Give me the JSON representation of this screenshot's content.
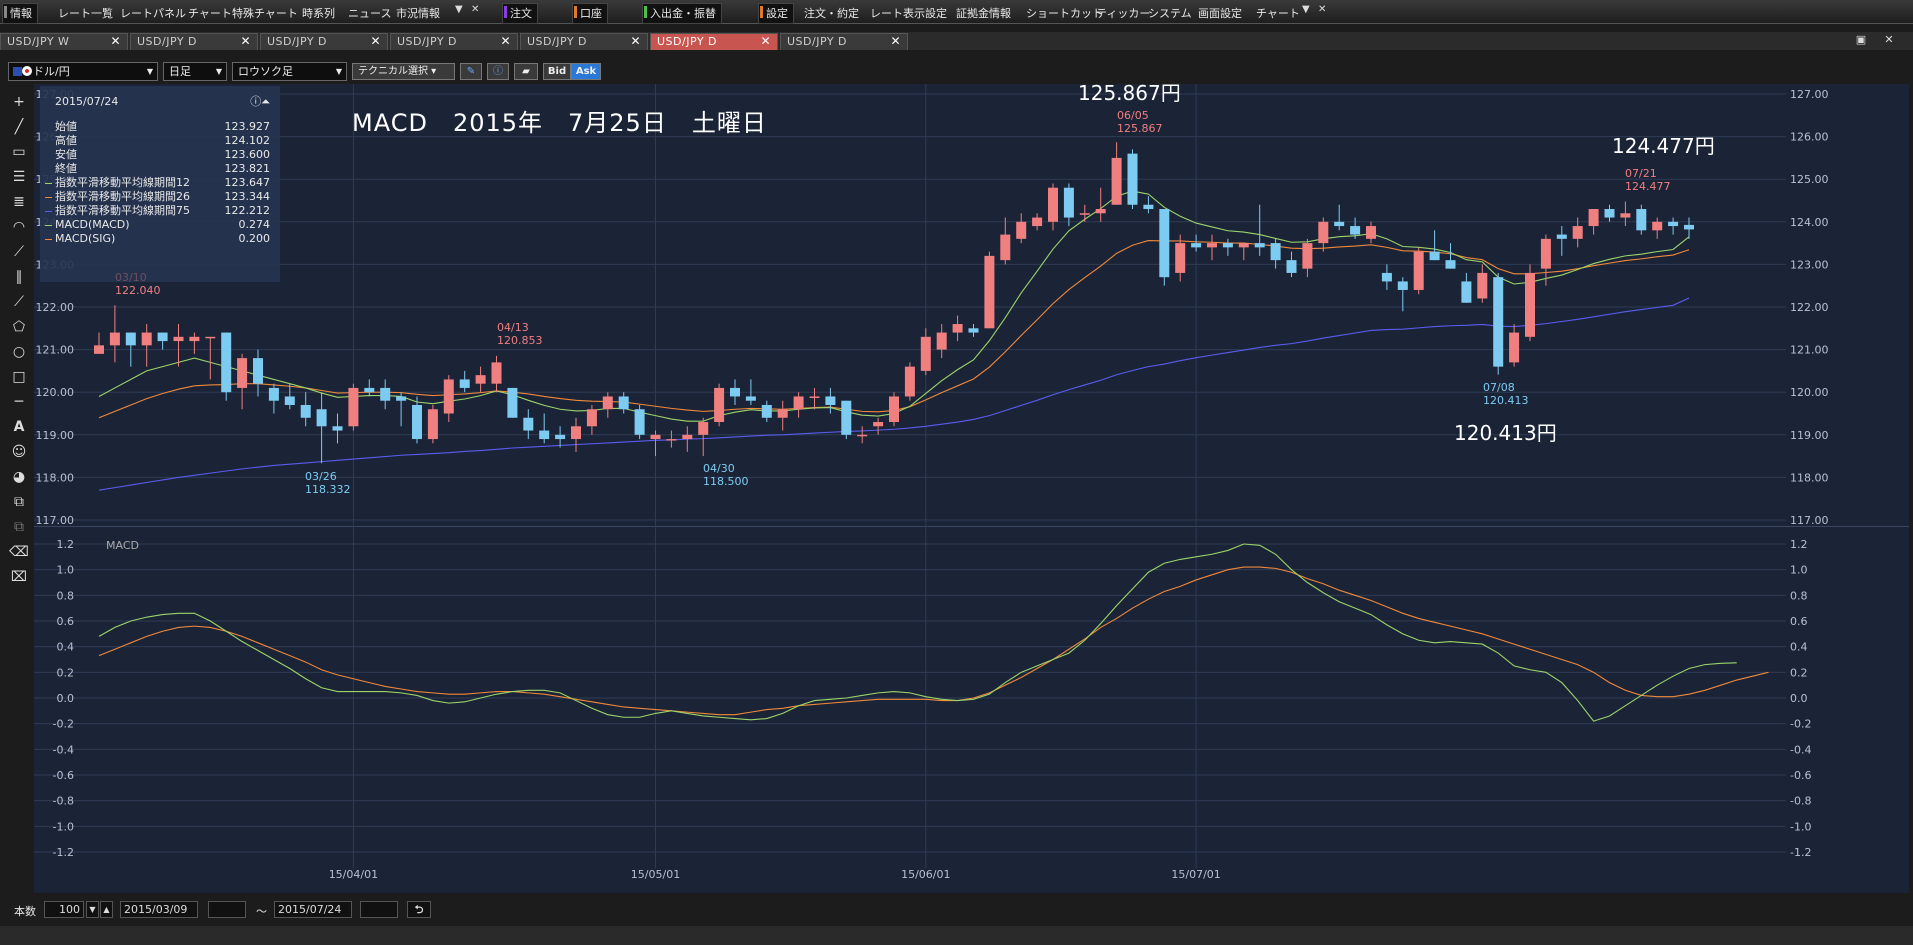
{
  "menu": {
    "items": [
      "情報",
      "レート一覧",
      "レートパネル",
      "チャート",
      "特殊チャート",
      "時系列",
      "ニュース",
      "市況情報",
      "注文",
      "口座",
      "入出金・振替",
      "設定",
      "注文・約定",
      "レート表示設定",
      "証拠金情報",
      "ショートカット",
      "ティッカー",
      "システム",
      "画面設定",
      "チャート"
    ]
  },
  "tabs": [
    {
      "label": "USD/JPY W"
    },
    {
      "label": "USD/JPY D"
    },
    {
      "label": "USD/JPY D"
    },
    {
      "label": "USD/JPY D"
    },
    {
      "label": "USD/JPY D"
    },
    {
      "label": "USD/JPY D"
    },
    {
      "label": "USD/JPY D"
    }
  ],
  "toolbar": {
    "pair": "ドル/円",
    "timeframe": "日足",
    "charttype": "ロウソク足",
    "technical": "テクニカル選択",
    "bid": "Bid",
    "ask": "Ask"
  },
  "info": {
    "date": "2015/07/24",
    "rows": [
      {
        "label": "始値",
        "value": "123.927",
        "color": ""
      },
      {
        "label": "高値",
        "value": "124.102",
        "color": ""
      },
      {
        "label": "安値",
        "value": "123.600",
        "color": ""
      },
      {
        "label": "終値",
        "value": "123.821",
        "color": ""
      },
      {
        "label": "指数平滑移動平均線期間12",
        "value": "123.647",
        "color": "#9cd46a"
      },
      {
        "label": "指数平滑移動平均線期間26",
        "value": "123.344",
        "color": "#f0883a"
      },
      {
        "label": "指数平滑移動平均線期間75",
        "value": "122.212",
        "color": "#5a5cf0"
      },
      {
        "label": "MACD(MACD)",
        "value": "0.274",
        "color": "#9cd46a"
      },
      {
        "label": "MACD(SIG)",
        "value": "0.200",
        "color": "#f0883a"
      }
    ]
  },
  "annotations": {
    "title": "MACD　2015年　7月25日　土曜日",
    "high_label": "125.867円",
    "right_label": "124.477円",
    "low_label": "120.413円",
    "peaks": [
      {
        "date": "06/05",
        "price": "125.867",
        "kind": "high"
      },
      {
        "date": "07/21",
        "price": "124.477",
        "kind": "high"
      },
      {
        "date": "04/13",
        "price": "120.853",
        "kind": "high"
      },
      {
        "date": "03/10",
        "price": "122.040",
        "kind": "high"
      },
      {
        "date": "03/26",
        "price": "118.332",
        "kind": "low"
      },
      {
        "date": "04/30",
        "price": "118.500",
        "kind": "low"
      },
      {
        "date": "07/08",
        "price": "120.413",
        "kind": "low"
      }
    ],
    "macd_label": "MACD"
  },
  "colors": {
    "up": "#f07f7f",
    "down": "#7ecbf2",
    "ema12": "#9cd46a",
    "ema26": "#f0883a",
    "ema75": "#5a5cf0",
    "bg": "#1b2437",
    "grid": "#2f3b55"
  },
  "chart_data": {
    "type": "candlestick",
    "price_axis": {
      "ylim": [
        117.0,
        127.0
      ],
      "ticks": [
        "117.00",
        "118.00",
        "119.00",
        "120.00",
        "121.00",
        "122.00",
        "123.00",
        "124.00",
        "125.00",
        "126.00",
        "127.00"
      ]
    },
    "macd_axis": {
      "ylim": [
        -1.2,
        1.2
      ],
      "ticks": [
        "-1.2",
        "-1.0",
        "-0.8",
        "-0.6",
        "-0.4",
        "-0.2",
        "0.0",
        "0.2",
        "0.4",
        "0.6",
        "0.8",
        "1.0",
        "1.2"
      ]
    },
    "x_ticks": [
      "15/04/01",
      "15/05/01",
      "15/06/01",
      "15/07/01"
    ],
    "candles": [
      [
        120.9,
        121.4,
        120.9,
        121.1
      ],
      [
        121.1,
        122.04,
        120.7,
        121.4
      ],
      [
        121.4,
        121.4,
        120.6,
        121.1
      ],
      [
        121.1,
        121.6,
        120.6,
        121.4
      ],
      [
        121.4,
        121.4,
        121.0,
        121.2
      ],
      [
        121.2,
        121.6,
        120.6,
        121.3
      ],
      [
        121.2,
        121.4,
        120.9,
        121.3
      ],
      [
        121.3,
        121.3,
        120.3,
        121.3
      ],
      [
        121.4,
        121.4,
        119.8,
        120.0
      ],
      [
        120.1,
        120.9,
        119.6,
        120.8
      ],
      [
        120.8,
        121.0,
        119.9,
        120.2
      ],
      [
        120.1,
        120.2,
        119.5,
        119.8
      ],
      [
        119.9,
        120.2,
        119.6,
        119.7
      ],
      [
        119.7,
        120.0,
        119.2,
        119.4
      ],
      [
        119.6,
        120.0,
        118.332,
        119.2
      ],
      [
        119.2,
        119.5,
        118.8,
        119.1
      ],
      [
        119.2,
        120.2,
        119.1,
        120.1
      ],
      [
        120.1,
        120.3,
        119.9,
        120.0
      ],
      [
        120.1,
        120.3,
        119.6,
        119.8
      ],
      [
        119.9,
        120.0,
        119.2,
        119.8
      ],
      [
        119.7,
        119.9,
        118.8,
        118.9
      ],
      [
        118.9,
        119.7,
        118.8,
        119.6
      ],
      [
        119.5,
        120.4,
        119.3,
        120.3
      ],
      [
        120.3,
        120.5,
        120.0,
        120.1
      ],
      [
        120.2,
        120.6,
        120.0,
        120.4
      ],
      [
        120.2,
        120.853,
        120.0,
        120.7
      ],
      [
        120.1,
        120.1,
        119.4,
        119.4
      ],
      [
        119.4,
        119.6,
        118.9,
        119.1
      ],
      [
        119.1,
        119.5,
        118.8,
        118.9
      ],
      [
        119.0,
        119.2,
        118.7,
        118.9
      ],
      [
        118.9,
        119.4,
        118.6,
        119.2
      ],
      [
        119.2,
        119.7,
        119.0,
        119.6
      ],
      [
        119.6,
        120.0,
        119.4,
        119.9
      ],
      [
        119.9,
        120.0,
        119.5,
        119.6
      ],
      [
        119.6,
        119.7,
        118.9,
        119.0
      ],
      [
        118.9,
        119.1,
        118.5,
        119.0
      ],
      [
        118.9,
        119.1,
        118.7,
        118.9
      ],
      [
        118.9,
        119.2,
        118.6,
        119.0
      ],
      [
        119.0,
        119.4,
        118.5,
        119.3
      ],
      [
        119.3,
        120.2,
        119.2,
        120.1
      ],
      [
        120.1,
        120.3,
        119.7,
        119.9
      ],
      [
        119.9,
        120.3,
        119.7,
        119.8
      ],
      [
        119.7,
        119.8,
        119.3,
        119.4
      ],
      [
        119.4,
        119.8,
        119.1,
        119.6
      ],
      [
        119.6,
        120.0,
        119.4,
        119.9
      ],
      [
        119.9,
        120.1,
        119.6,
        119.9
      ],
      [
        119.9,
        120.1,
        119.5,
        119.7
      ],
      [
        119.8,
        119.8,
        118.9,
        119.0
      ],
      [
        119.0,
        119.2,
        118.8,
        119.0
      ],
      [
        119.2,
        119.4,
        119.0,
        119.3
      ],
      [
        119.3,
        120.0,
        119.2,
        119.9
      ],
      [
        119.9,
        120.7,
        119.8,
        120.6
      ],
      [
        120.5,
        121.5,
        120.4,
        121.3
      ],
      [
        121.0,
        121.6,
        120.8,
        121.4
      ],
      [
        121.4,
        121.8,
        121.2,
        121.6
      ],
      [
        121.5,
        121.6,
        121.3,
        121.4
      ],
      [
        121.5,
        123.3,
        121.5,
        123.2
      ],
      [
        123.1,
        124.1,
        123.0,
        123.7
      ],
      [
        123.6,
        124.2,
        123.5,
        124.0
      ],
      [
        123.9,
        124.2,
        123.8,
        124.1
      ],
      [
        124.0,
        124.9,
        123.8,
        124.8
      ],
      [
        124.8,
        124.9,
        123.9,
        124.1
      ],
      [
        124.2,
        124.4,
        124.0,
        124.2
      ],
      [
        124.2,
        124.8,
        124.0,
        124.3
      ],
      [
        124.4,
        125.867,
        124.4,
        125.5
      ],
      [
        125.6,
        125.7,
        124.3,
        124.4
      ],
      [
        124.4,
        124.6,
        124.2,
        124.3
      ],
      [
        124.3,
        124.3,
        122.5,
        122.7
      ],
      [
        122.8,
        123.7,
        122.6,
        123.5
      ],
      [
        123.5,
        123.7,
        123.3,
        123.4
      ],
      [
        123.4,
        123.7,
        123.1,
        123.5
      ],
      [
        123.5,
        123.6,
        123.2,
        123.4
      ],
      [
        123.4,
        123.5,
        123.1,
        123.5
      ],
      [
        123.5,
        124.4,
        123.2,
        123.4
      ],
      [
        123.5,
        123.6,
        122.9,
        123.1
      ],
      [
        123.1,
        123.3,
        122.7,
        122.8
      ],
      [
        122.9,
        123.6,
        122.7,
        123.5
      ],
      [
        123.5,
        124.1,
        123.3,
        124.0
      ],
      [
        124.0,
        124.4,
        123.8,
        123.9
      ],
      [
        123.9,
        124.1,
        123.6,
        123.7
      ],
      [
        123.6,
        124.0,
        123.5,
        123.9
      ],
      [
        122.8,
        123.0,
        122.4,
        122.6
      ],
      [
        122.6,
        122.7,
        121.9,
        122.4
      ],
      [
        122.4,
        123.4,
        122.3,
        123.3
      ],
      [
        123.3,
        123.8,
        123.1,
        123.1
      ],
      [
        123.1,
        123.5,
        122.9,
        122.9
      ],
      [
        122.6,
        122.8,
        122.1,
        122.1
      ],
      [
        122.2,
        123.0,
        122.1,
        122.8
      ],
      [
        122.7,
        122.8,
        120.413,
        120.6
      ],
      [
        120.7,
        121.6,
        120.6,
        121.4
      ],
      [
        121.3,
        123.0,
        121.2,
        122.8
      ],
      [
        122.9,
        123.7,
        122.5,
        123.6
      ],
      [
        123.7,
        123.9,
        123.2,
        123.6
      ],
      [
        123.6,
        124.1,
        123.4,
        123.9
      ],
      [
        123.9,
        124.3,
        123.7,
        124.3
      ],
      [
        124.3,
        124.4,
        124.0,
        124.1
      ],
      [
        124.1,
        124.477,
        123.9,
        124.2
      ],
      [
        124.3,
        124.4,
        123.7,
        123.8
      ],
      [
        123.8,
        124.1,
        123.6,
        124.0
      ],
      [
        124.0,
        124.1,
        123.7,
        123.9
      ],
      [
        123.927,
        124.102,
        123.6,
        123.821
      ]
    ],
    "ema12": [
      119.9,
      120.1,
      120.3,
      120.5,
      120.6,
      120.7,
      120.8,
      120.7,
      120.6,
      120.5,
      120.4,
      120.3,
      120.2,
      120.1,
      119.98,
      119.88,
      119.9,
      119.92,
      119.92,
      119.9,
      119.77,
      119.73,
      119.79,
      119.84,
      119.92,
      120.03,
      119.94,
      119.81,
      119.69,
      119.6,
      119.56,
      119.57,
      119.62,
      119.62,
      119.53,
      119.45,
      119.37,
      119.32,
      119.32,
      119.45,
      119.53,
      119.59,
      119.56,
      119.56,
      119.6,
      119.63,
      119.64,
      119.54,
      119.46,
      119.44,
      119.5,
      119.67,
      119.97,
      120.27,
      120.53,
      120.76,
      121.21,
      121.75,
      122.33,
      122.84,
      123.36,
      123.79,
      124.06,
      124.31,
      124.6,
      124.72,
      124.65,
      124.34,
      124.13,
      123.97,
      123.88,
      123.79,
      123.76,
      123.7,
      123.61,
      123.52,
      123.53,
      123.6,
      123.65,
      123.67,
      123.72,
      123.6,
      123.42,
      123.4,
      123.36,
      123.28,
      123.11,
      123.06,
      122.7,
      122.54,
      122.58,
      122.67,
      122.75,
      122.88,
      123.02,
      123.12,
      123.2,
      123.24,
      123.3,
      123.35,
      123.647
    ],
    "ema26": [
      119.4,
      119.55,
      119.7,
      119.85,
      119.97,
      120.07,
      120.15,
      120.17,
      120.18,
      120.2,
      120.2,
      120.17,
      120.14,
      120.1,
      120.04,
      119.98,
      119.99,
      120.0,
      120.0,
      119.99,
      119.95,
      119.92,
      119.94,
      119.96,
      119.99,
      120.03,
      120.0,
      119.96,
      119.9,
      119.85,
      119.81,
      119.79,
      119.78,
      119.77,
      119.72,
      119.67,
      119.62,
      119.58,
      119.55,
      119.57,
      119.6,
      119.62,
      119.61,
      119.6,
      119.62,
      119.64,
      119.65,
      119.6,
      119.55,
      119.54,
      119.57,
      119.66,
      119.82,
      119.99,
      120.15,
      120.31,
      120.59,
      120.95,
      121.33,
      121.7,
      122.08,
      122.41,
      122.69,
      122.96,
      123.26,
      123.45,
      123.56,
      123.55,
      123.55,
      123.53,
      123.52,
      123.5,
      123.5,
      123.47,
      123.43,
      123.38,
      123.37,
      123.38,
      123.41,
      123.43,
      123.46,
      123.4,
      123.32,
      123.31,
      123.29,
      123.25,
      123.16,
      123.11,
      122.9,
      122.78,
      122.78,
      122.81,
      122.84,
      122.9,
      122.97,
      123.03,
      123.09,
      123.13,
      123.18,
      123.22,
      123.344
    ],
    "ema75": [
      117.7,
      117.76,
      117.82,
      117.88,
      117.94,
      118.0,
      118.05,
      118.1,
      118.15,
      118.2,
      118.24,
      118.28,
      118.31,
      118.34,
      118.37,
      118.4,
      118.43,
      118.46,
      118.49,
      118.52,
      118.54,
      118.56,
      118.58,
      118.61,
      118.63,
      118.66,
      118.69,
      118.71,
      118.73,
      118.75,
      118.77,
      118.79,
      118.81,
      118.83,
      118.85,
      118.87,
      118.88,
      118.9,
      118.91,
      118.93,
      118.95,
      118.97,
      118.99,
      119.0,
      119.02,
      119.04,
      119.06,
      119.08,
      119.09,
      119.11,
      119.13,
      119.16,
      119.2,
      119.25,
      119.3,
      119.36,
      119.45,
      119.57,
      119.69,
      119.81,
      119.94,
      120.06,
      120.17,
      120.28,
      120.41,
      120.51,
      120.6,
      120.66,
      120.74,
      120.81,
      120.87,
      120.93,
      120.99,
      121.05,
      121.1,
      121.14,
      121.2,
      121.27,
      121.33,
      121.39,
      121.45,
      121.47,
      121.48,
      121.51,
      121.54,
      121.56,
      121.57,
      121.59,
      121.55,
      121.54,
      121.57,
      121.61,
      121.66,
      121.71,
      121.77,
      121.83,
      121.89,
      121.94,
      121.99,
      122.04,
      122.212
    ],
    "macd": [
      0.48,
      0.55,
      0.6,
      0.63,
      0.65,
      0.66,
      0.66,
      0.6,
      0.52,
      0.44,
      0.37,
      0.3,
      0.23,
      0.15,
      0.08,
      0.05,
      0.05,
      0.05,
      0.05,
      0.04,
      0.02,
      -0.02,
      -0.04,
      -0.03,
      0.0,
      0.03,
      0.05,
      0.06,
      0.06,
      0.04,
      -0.02,
      -0.08,
      -0.13,
      -0.15,
      -0.15,
      -0.12,
      -0.1,
      -0.12,
      -0.14,
      -0.15,
      -0.16,
      -0.17,
      -0.16,
      -0.12,
      -0.06,
      -0.02,
      -0.01,
      0.0,
      0.02,
      0.04,
      0.05,
      0.04,
      0.01,
      -0.01,
      -0.02,
      -0.01,
      0.03,
      0.12,
      0.2,
      0.25,
      0.3,
      0.35,
      0.45,
      0.58,
      0.72,
      0.85,
      0.98,
      1.05,
      1.08,
      1.1,
      1.12,
      1.15,
      1.2,
      1.19,
      1.12,
      1.0,
      0.9,
      0.82,
      0.75,
      0.7,
      0.65,
      0.57,
      0.5,
      0.45,
      0.43,
      0.44,
      0.43,
      0.42,
      0.35,
      0.25,
      0.22,
      0.2,
      0.12,
      -0.02,
      -0.18,
      -0.14,
      -0.06,
      0.02,
      0.1,
      0.17,
      0.23,
      0.26,
      0.27,
      0.274
    ],
    "sig": [
      0.33,
      0.38,
      0.43,
      0.48,
      0.52,
      0.55,
      0.56,
      0.55,
      0.52,
      0.48,
      0.43,
      0.38,
      0.33,
      0.28,
      0.22,
      0.18,
      0.15,
      0.12,
      0.09,
      0.07,
      0.05,
      0.04,
      0.03,
      0.03,
      0.04,
      0.05,
      0.05,
      0.04,
      0.03,
      0.01,
      -0.01,
      -0.03,
      -0.05,
      -0.07,
      -0.08,
      -0.09,
      -0.1,
      -0.11,
      -0.12,
      -0.13,
      -0.13,
      -0.11,
      -0.09,
      -0.08,
      -0.06,
      -0.05,
      -0.04,
      -0.03,
      -0.02,
      -0.01,
      -0.01,
      -0.01,
      -0.01,
      -0.02,
      -0.02,
      0.0,
      0.04,
      0.1,
      0.16,
      0.23,
      0.3,
      0.38,
      0.46,
      0.55,
      0.62,
      0.7,
      0.77,
      0.83,
      0.87,
      0.92,
      0.96,
      1.0,
      1.02,
      1.02,
      1.01,
      0.98,
      0.93,
      0.89,
      0.84,
      0.8,
      0.76,
      0.71,
      0.66,
      0.62,
      0.59,
      0.56,
      0.53,
      0.5,
      0.46,
      0.42,
      0.38,
      0.34,
      0.3,
      0.26,
      0.2,
      0.12,
      0.06,
      0.02,
      0.01,
      0.01,
      0.03,
      0.06,
      0.1,
      0.14,
      0.17,
      0.2
    ]
  },
  "bottom": {
    "count_label": "本数",
    "count": "100",
    "from": "2015/03/09",
    "tilde": "～",
    "to": "2015/07/24"
  }
}
